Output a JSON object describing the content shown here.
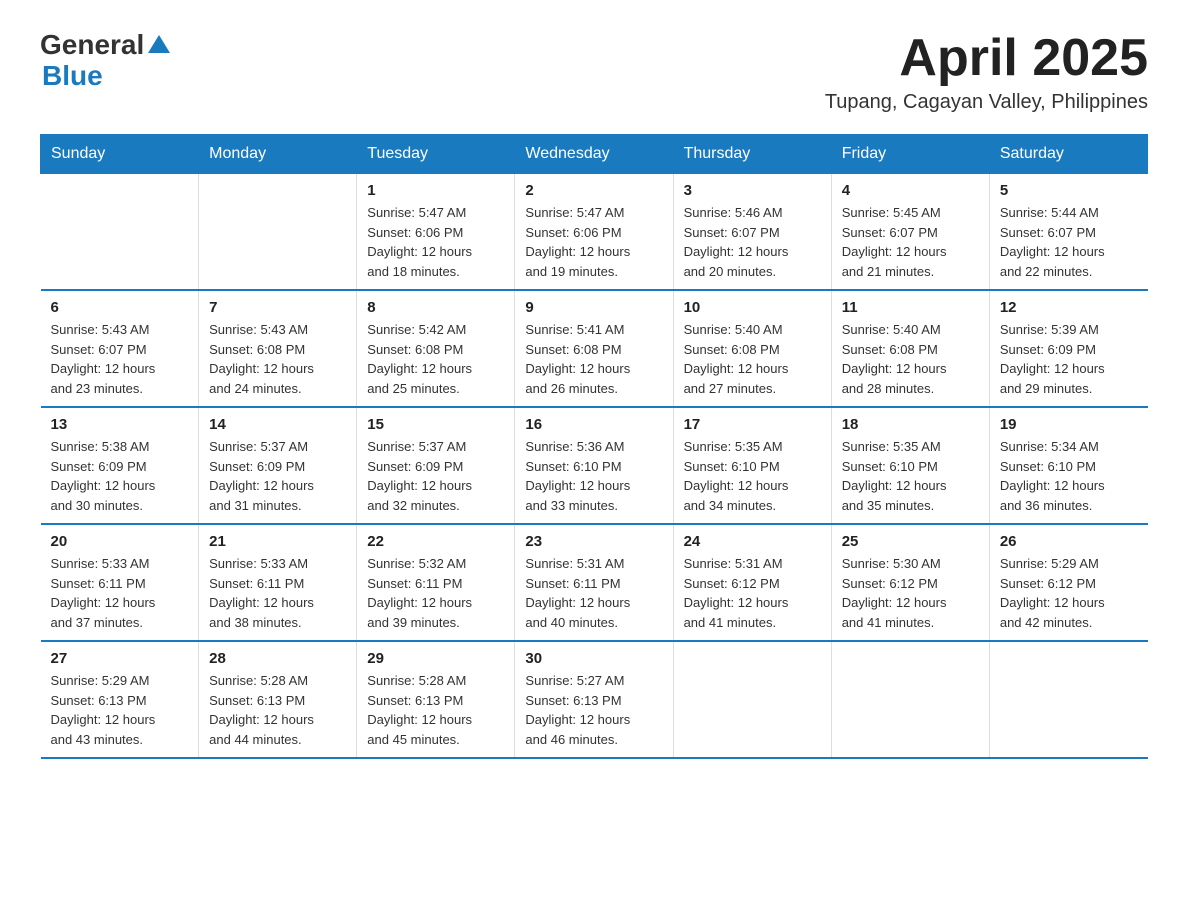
{
  "header": {
    "logo_general": "General",
    "logo_blue": "Blue",
    "month_title": "April 2025",
    "location": "Tupang, Cagayan Valley, Philippines"
  },
  "weekdays": [
    "Sunday",
    "Monday",
    "Tuesday",
    "Wednesday",
    "Thursday",
    "Friday",
    "Saturday"
  ],
  "weeks": [
    [
      {
        "day": "",
        "info": ""
      },
      {
        "day": "",
        "info": ""
      },
      {
        "day": "1",
        "info": "Sunrise: 5:47 AM\nSunset: 6:06 PM\nDaylight: 12 hours\nand 18 minutes."
      },
      {
        "day": "2",
        "info": "Sunrise: 5:47 AM\nSunset: 6:06 PM\nDaylight: 12 hours\nand 19 minutes."
      },
      {
        "day": "3",
        "info": "Sunrise: 5:46 AM\nSunset: 6:07 PM\nDaylight: 12 hours\nand 20 minutes."
      },
      {
        "day": "4",
        "info": "Sunrise: 5:45 AM\nSunset: 6:07 PM\nDaylight: 12 hours\nand 21 minutes."
      },
      {
        "day": "5",
        "info": "Sunrise: 5:44 AM\nSunset: 6:07 PM\nDaylight: 12 hours\nand 22 minutes."
      }
    ],
    [
      {
        "day": "6",
        "info": "Sunrise: 5:43 AM\nSunset: 6:07 PM\nDaylight: 12 hours\nand 23 minutes."
      },
      {
        "day": "7",
        "info": "Sunrise: 5:43 AM\nSunset: 6:08 PM\nDaylight: 12 hours\nand 24 minutes."
      },
      {
        "day": "8",
        "info": "Sunrise: 5:42 AM\nSunset: 6:08 PM\nDaylight: 12 hours\nand 25 minutes."
      },
      {
        "day": "9",
        "info": "Sunrise: 5:41 AM\nSunset: 6:08 PM\nDaylight: 12 hours\nand 26 minutes."
      },
      {
        "day": "10",
        "info": "Sunrise: 5:40 AM\nSunset: 6:08 PM\nDaylight: 12 hours\nand 27 minutes."
      },
      {
        "day": "11",
        "info": "Sunrise: 5:40 AM\nSunset: 6:08 PM\nDaylight: 12 hours\nand 28 minutes."
      },
      {
        "day": "12",
        "info": "Sunrise: 5:39 AM\nSunset: 6:09 PM\nDaylight: 12 hours\nand 29 minutes."
      }
    ],
    [
      {
        "day": "13",
        "info": "Sunrise: 5:38 AM\nSunset: 6:09 PM\nDaylight: 12 hours\nand 30 minutes."
      },
      {
        "day": "14",
        "info": "Sunrise: 5:37 AM\nSunset: 6:09 PM\nDaylight: 12 hours\nand 31 minutes."
      },
      {
        "day": "15",
        "info": "Sunrise: 5:37 AM\nSunset: 6:09 PM\nDaylight: 12 hours\nand 32 minutes."
      },
      {
        "day": "16",
        "info": "Sunrise: 5:36 AM\nSunset: 6:10 PM\nDaylight: 12 hours\nand 33 minutes."
      },
      {
        "day": "17",
        "info": "Sunrise: 5:35 AM\nSunset: 6:10 PM\nDaylight: 12 hours\nand 34 minutes."
      },
      {
        "day": "18",
        "info": "Sunrise: 5:35 AM\nSunset: 6:10 PM\nDaylight: 12 hours\nand 35 minutes."
      },
      {
        "day": "19",
        "info": "Sunrise: 5:34 AM\nSunset: 6:10 PM\nDaylight: 12 hours\nand 36 minutes."
      }
    ],
    [
      {
        "day": "20",
        "info": "Sunrise: 5:33 AM\nSunset: 6:11 PM\nDaylight: 12 hours\nand 37 minutes."
      },
      {
        "day": "21",
        "info": "Sunrise: 5:33 AM\nSunset: 6:11 PM\nDaylight: 12 hours\nand 38 minutes."
      },
      {
        "day": "22",
        "info": "Sunrise: 5:32 AM\nSunset: 6:11 PM\nDaylight: 12 hours\nand 39 minutes."
      },
      {
        "day": "23",
        "info": "Sunrise: 5:31 AM\nSunset: 6:11 PM\nDaylight: 12 hours\nand 40 minutes."
      },
      {
        "day": "24",
        "info": "Sunrise: 5:31 AM\nSunset: 6:12 PM\nDaylight: 12 hours\nand 41 minutes."
      },
      {
        "day": "25",
        "info": "Sunrise: 5:30 AM\nSunset: 6:12 PM\nDaylight: 12 hours\nand 41 minutes."
      },
      {
        "day": "26",
        "info": "Sunrise: 5:29 AM\nSunset: 6:12 PM\nDaylight: 12 hours\nand 42 minutes."
      }
    ],
    [
      {
        "day": "27",
        "info": "Sunrise: 5:29 AM\nSunset: 6:13 PM\nDaylight: 12 hours\nand 43 minutes."
      },
      {
        "day": "28",
        "info": "Sunrise: 5:28 AM\nSunset: 6:13 PM\nDaylight: 12 hours\nand 44 minutes."
      },
      {
        "day": "29",
        "info": "Sunrise: 5:28 AM\nSunset: 6:13 PM\nDaylight: 12 hours\nand 45 minutes."
      },
      {
        "day": "30",
        "info": "Sunrise: 5:27 AM\nSunset: 6:13 PM\nDaylight: 12 hours\nand 46 minutes."
      },
      {
        "day": "",
        "info": ""
      },
      {
        "day": "",
        "info": ""
      },
      {
        "day": "",
        "info": ""
      }
    ]
  ]
}
